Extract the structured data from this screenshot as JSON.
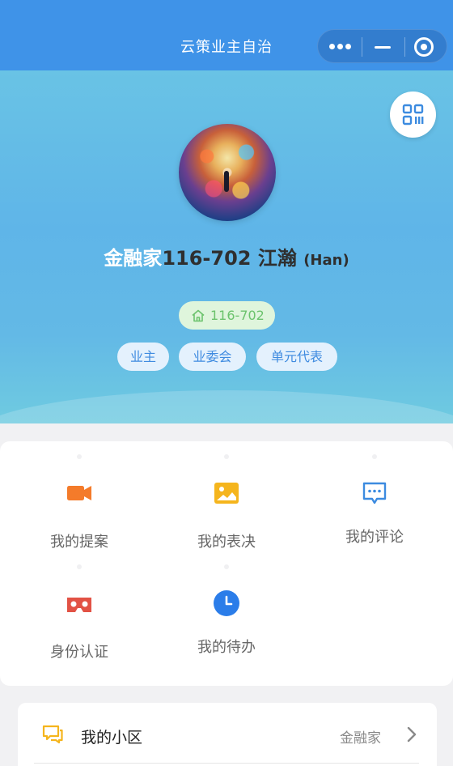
{
  "navbar": {
    "title": "云策业主自治",
    "capsule_icons": [
      "more-dots-icon",
      "minimize-icon",
      "close-target-icon"
    ]
  },
  "profile": {
    "community": "金融家",
    "unit_in_name": "116-702",
    "person": "江瀚",
    "suffix": "(Han)",
    "unit_tag": "116-702",
    "roles": [
      "业主",
      "业委会",
      "单元代表"
    ],
    "colors": {
      "hero_top": "#69c3e5",
      "unit_tag_text": "#6cc36d",
      "role_tag_text": "#3f8be0"
    }
  },
  "features": [
    {
      "label": "我的提案",
      "icon": "video-camera-icon",
      "color": "#f47b2a"
    },
    {
      "label": "我的表决",
      "icon": "image-icon",
      "color": "#f5b51d"
    },
    {
      "label": "我的评论",
      "icon": "comment-icon",
      "color": "#3c8be0"
    },
    {
      "label": "身份认证",
      "icon": "vr-goggles-icon",
      "color": "#e25245"
    },
    {
      "label": "我的待办",
      "icon": "clock-icon",
      "color": "#2b7de9"
    }
  ],
  "list": [
    {
      "title": "我的小区",
      "value": "金融家",
      "icon": "chat-bubbles-icon",
      "icon_color": "#f5b51d"
    }
  ]
}
